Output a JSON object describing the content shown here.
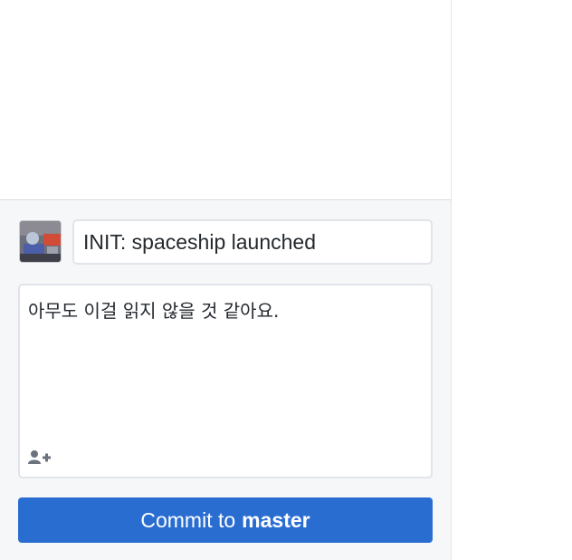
{
  "commit": {
    "summary_value": "INIT: spaceship launched",
    "description_value": "아무도 이걸 읽지 않을 것 같아요.",
    "button_prefix": "Commit to",
    "branch_name": "master"
  },
  "icons": {
    "avatar": "user-avatar",
    "coauthor": "add-coauthor-icon"
  },
  "colors": {
    "accent": "#2a6dd1",
    "panel_background": "#f6f7f9",
    "border": "#e1e4e8",
    "text": "#24292e"
  }
}
